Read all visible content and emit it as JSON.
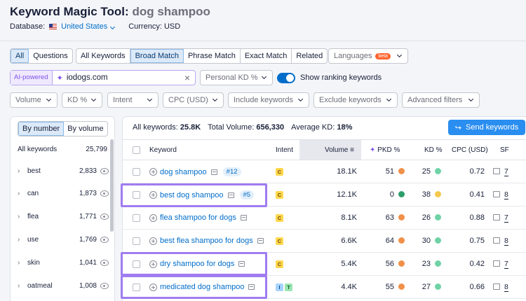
{
  "header": {
    "tool_title": "Keyword Magic Tool:",
    "query": "dog shampoo",
    "database_label": "Database:",
    "database_value": "United States",
    "currency_label": "Currency: USD"
  },
  "filters": {
    "group_tabs": [
      "All",
      "Questions"
    ],
    "match_tabs": [
      "All Keywords",
      "Broad Match",
      "Phrase Match",
      "Exact Match",
      "Related"
    ],
    "languages_label": "Languages",
    "languages_badge": "beta",
    "ai_powered_label": "AI-powered",
    "domain_value": "iodogs.com",
    "personal_kd_label": "Personal KD %",
    "show_ranking_label": "Show ranking keywords",
    "dropdowns": [
      "Volume",
      "KD %",
      "Intent",
      "CPC (USD)",
      "Include keywords",
      "Exclude keywords",
      "Advanced filters"
    ]
  },
  "sidebar": {
    "view_tabs": [
      "By number",
      "By volume"
    ],
    "header_label": "All keywords",
    "header_count": "25,799",
    "items": [
      {
        "label": "best",
        "count": "2,833"
      },
      {
        "label": "can",
        "count": "1,873"
      },
      {
        "label": "flea",
        "count": "1,771"
      },
      {
        "label": "use",
        "count": "1,769"
      },
      {
        "label": "skin",
        "count": "1,041"
      },
      {
        "label": "oatmeal",
        "count": "1,008"
      }
    ]
  },
  "summary": {
    "all_keywords_label": "All keywords:",
    "all_keywords_value": "25.8K",
    "total_volume_label": "Total Volume:",
    "total_volume_value": "656,330",
    "avg_kd_label": "Average KD:",
    "avg_kd_value": "18%",
    "send_button": "Send keywords"
  },
  "table": {
    "columns": [
      "Keyword",
      "Intent",
      "Volume",
      "PKD %",
      "KD %",
      "CPC (USD)",
      "SF"
    ],
    "rows": [
      {
        "keyword": "dog shampoo",
        "rank": "#12",
        "intents": [
          "C"
        ],
        "volume": "18.1K",
        "pkd": "51",
        "pkd_color": "#f0904a",
        "kd": "25",
        "kd_color": "#6fd3a6",
        "cpc": "0.72",
        "sf": "7"
      },
      {
        "keyword": "best dog shampoo",
        "rank": "#5",
        "intents": [
          "C"
        ],
        "volume": "12.1K",
        "pkd": "0",
        "pkd_color": "#2e9e6b",
        "kd": "38",
        "kd_color": "#f5c84c",
        "cpc": "0.41",
        "sf": "8"
      },
      {
        "keyword": "flea shampoo for dogs",
        "rank": "",
        "intents": [
          "C"
        ],
        "volume": "8.1K",
        "pkd": "63",
        "pkd_color": "#f0904a",
        "kd": "26",
        "kd_color": "#6fd3a6",
        "cpc": "0.88",
        "sf": "7"
      },
      {
        "keyword": "best flea shampoo for dogs",
        "rank": "",
        "intents": [
          "C"
        ],
        "volume": "6.6K",
        "pkd": "64",
        "pkd_color": "#f0904a",
        "kd": "30",
        "kd_color": "#6fd3a6",
        "cpc": "0.75",
        "sf": "8"
      },
      {
        "keyword": "dry shampoo for dogs",
        "rank": "",
        "intents": [
          "C"
        ],
        "volume": "5.4K",
        "pkd": "56",
        "pkd_color": "#f0904a",
        "kd": "23",
        "kd_color": "#6fd3a6",
        "cpc": "0.42",
        "sf": "7"
      },
      {
        "keyword": "medicated dog shampoo",
        "rank": "",
        "intents": [
          "I",
          "T"
        ],
        "volume": "4.4K",
        "pkd": "55",
        "pkd_color": "#f0904a",
        "kd": "27",
        "kd_color": "#6fd3a6",
        "cpc": "0.66",
        "sf": "8"
      }
    ]
  },
  "colors": {
    "accent": "#006dca",
    "highlight": "#a07cf0",
    "button": "#2a8ef0"
  }
}
